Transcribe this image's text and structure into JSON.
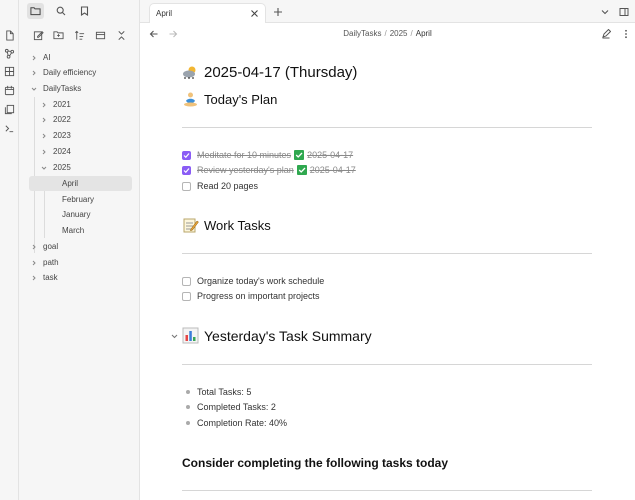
{
  "tab": {
    "title": "April"
  },
  "breadcrumb": {
    "parts": [
      "DailyTasks",
      "2025",
      "April"
    ]
  },
  "tree": {
    "ai": "AI",
    "daily_efficiency": "Daily efficiency",
    "dailytasks": "DailyTasks",
    "y2021": "2021",
    "y2022": "2022",
    "y2023": "2023",
    "y2024": "2024",
    "y2025": "2025",
    "april": "April",
    "february": "February",
    "january": "January",
    "march": "March",
    "goal": "goal",
    "path": "path",
    "task": "task"
  },
  "note": {
    "title": "2025-04-17 (Thursday)",
    "plan_heading": "Today's Plan",
    "plan_tasks": [
      {
        "text": "Meditate for 10 minutes",
        "done": true,
        "date": "2025-04-17"
      },
      {
        "text": "Review yesterday's plan",
        "done": true,
        "date": "2025-04-17"
      },
      {
        "text": "Read 20 pages",
        "done": false
      }
    ],
    "work_heading": "Work Tasks",
    "work_tasks": [
      {
        "text": "Organize today's work schedule",
        "done": false
      },
      {
        "text": "Progress on important projects",
        "done": false
      }
    ],
    "summary_heading": "Yesterday's Task Summary",
    "summary_items": [
      "Total Tasks: 5",
      "Completed Tasks: 2",
      "Completion Rate: 40%"
    ],
    "consider_heading": "Consider completing the following tasks today"
  },
  "colors": {
    "accent": "#8a5cf5",
    "check_emoji": "#2fa84f"
  }
}
